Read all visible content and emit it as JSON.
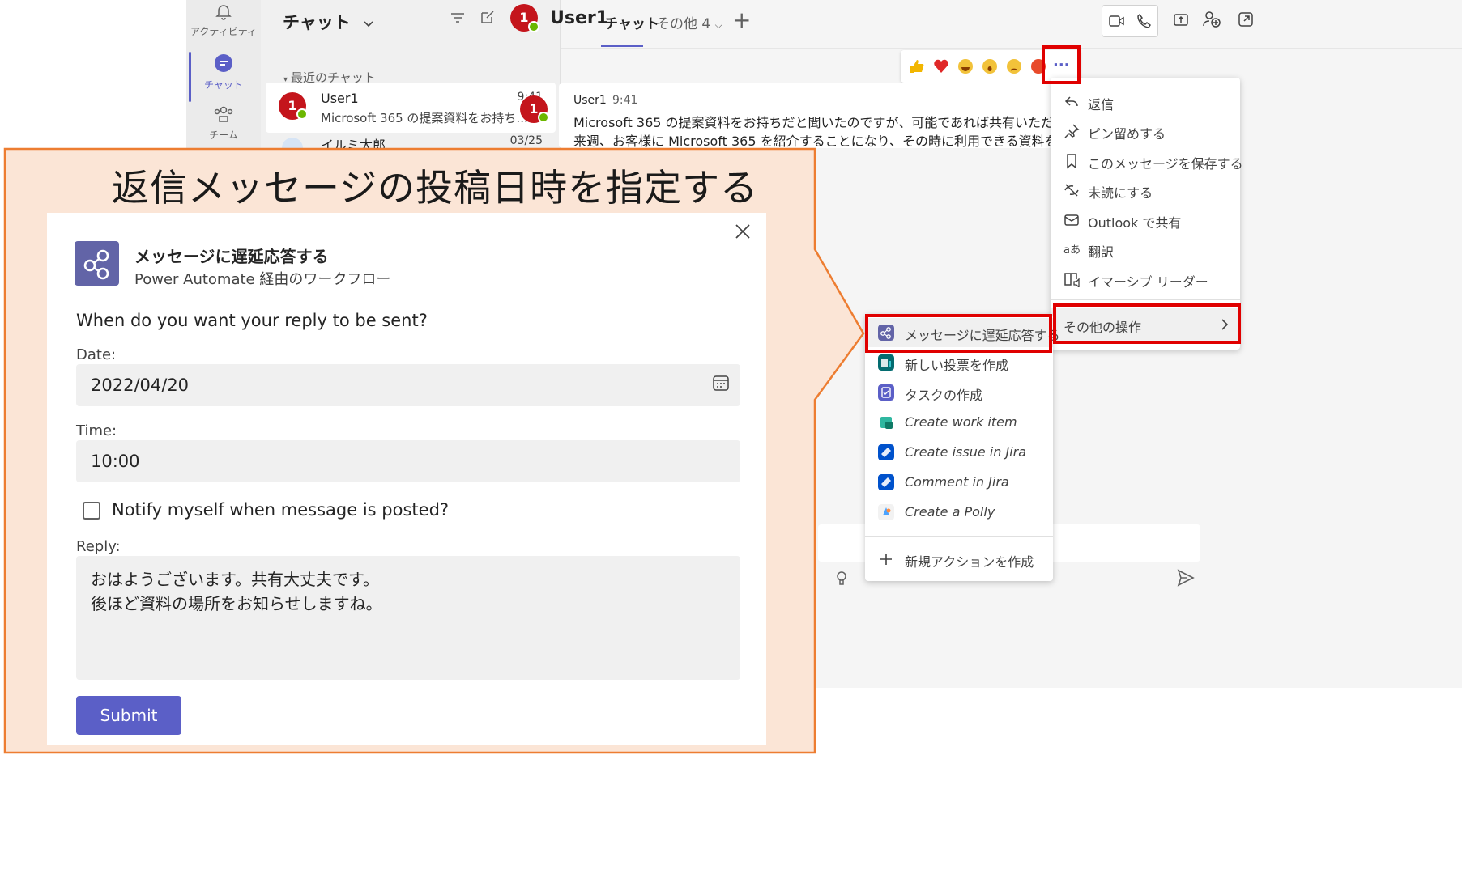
{
  "rail": {
    "activity": "アクティビティ",
    "chat": "チャット",
    "team": "チーム"
  },
  "chat_list": {
    "title": "チャット",
    "recent_label": "最近のチャット",
    "items": [
      {
        "name": "User1",
        "time": "9:41",
        "preview": "Microsoft 365 の提案資料をお持ち...",
        "badge": "1"
      },
      {
        "name": "イルミ太郎",
        "time": "03/25"
      }
    ]
  },
  "conversation": {
    "title": "User1",
    "avatar_badge": "1",
    "tab_chat": "チャット",
    "tab_more": "その他 4",
    "message": {
      "sender": "User1",
      "time": "9:41",
      "line1": "Microsoft 365 の提案資料をお持ちだと聞いたのですが、可能であれば共有いただけませんか",
      "line2": "来週、お客様に Microsoft 365 を紹介することになり、その時に利用できる資料を探しています"
    }
  },
  "context_menu": {
    "items": [
      {
        "label": "返信",
        "icon": "reply-icon"
      },
      {
        "label": "ピン留めする",
        "icon": "pin-icon"
      },
      {
        "label": "このメッセージを保存する",
        "icon": "bookmark-icon"
      },
      {
        "label": "未読にする",
        "icon": "unread-icon"
      },
      {
        "label": "Outlook で共有",
        "icon": "mail-icon"
      },
      {
        "label": "翻訳",
        "icon": "translate-icon"
      },
      {
        "label": "イマーシブ リーダー",
        "icon": "immersive-reader-icon"
      }
    ],
    "more_actions": "その他の操作"
  },
  "submenu": {
    "items": [
      {
        "label": "メッセージに遅延応答する",
        "icon_color": "#6264a7"
      },
      {
        "label": "新しい投票を作成",
        "icon_color": "#036c70"
      },
      {
        "label": "タスクの作成",
        "icon_color": "#5b5fc7"
      },
      {
        "label": "Create work item",
        "icon_color": "#2fb7a0"
      },
      {
        "label": "Create issue in Jira",
        "icon_color": "#0052cc"
      },
      {
        "label": "Comment in Jira",
        "icon_color": "#0052cc"
      },
      {
        "label": "Create a Polly",
        "icon_color": "#f2f2f2"
      }
    ],
    "new_action": "新規アクションを作成"
  },
  "callout": {
    "title": "返信メッセージの投稿日時を指定する"
  },
  "dialog": {
    "title": "メッセージに遅延応答する",
    "subtitle": "Power Automate 経由のワークフロー",
    "question": "When do you want your reply to be sent?",
    "date_label": "Date:",
    "date_value": "2022/04/20",
    "time_label": "Time:",
    "time_value": "10:00",
    "notify_label": "Notify myself when message is posted?",
    "notify_checked": false,
    "reply_label": "Reply:",
    "reply_line1": "おはようございます。共有大丈夫です。",
    "reply_line2": "後ほど資料の場所をお知らせしますね。",
    "submit_label": "Submit"
  },
  "colors": {
    "accent": "#5b5fc7",
    "highlight": "#e00000",
    "callout_fill": "#fbe5d6",
    "callout_border": "#ed7d31"
  }
}
